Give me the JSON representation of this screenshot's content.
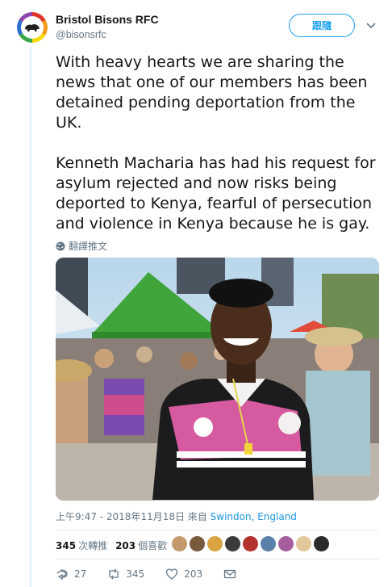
{
  "tweet": {
    "author_name": "Bristol Bisons RFC",
    "author_handle": "@bisonsrfc",
    "follow_label": "跟隨",
    "paragraphs": [
      "With heavy hearts we are sharing the news that one of our members has been detained pending deportation from the UK.",
      "Kenneth Macharia has had his request for asylum rejected and now risks being deported to Kenya, fearful of persecution and violence in Kenya because he is gay."
    ],
    "translate_label": "翻譯推文",
    "timestamp": "上午9:47 - 2018年11月18日 來自",
    "location": "Swindon, England",
    "retweet_count": "345",
    "retweet_label": "次轉推",
    "like_count": "203",
    "like_label": "個喜歡",
    "reply_count": "27",
    "action_retweets": "345",
    "action_likes": "203"
  },
  "colors": {
    "accent": "#1da1f2",
    "link": "#1b95e0",
    "muted": "#657786",
    "thread_line": "#d8f2fd"
  },
  "icons": {
    "follow_menu": "chevron-down-icon",
    "translate": "globe-icon",
    "reply": "reply-icon",
    "retweet": "retweet-icon",
    "like": "heart-icon",
    "dm": "envelope-icon"
  },
  "liker_colors": [
    "#c49a6c",
    "#7a5a3c",
    "#d9a441",
    "#3b3b3b",
    "#b5332e",
    "#5a7fa8",
    "#a65f9e",
    "#e2c79a",
    "#2b2b2b"
  ]
}
